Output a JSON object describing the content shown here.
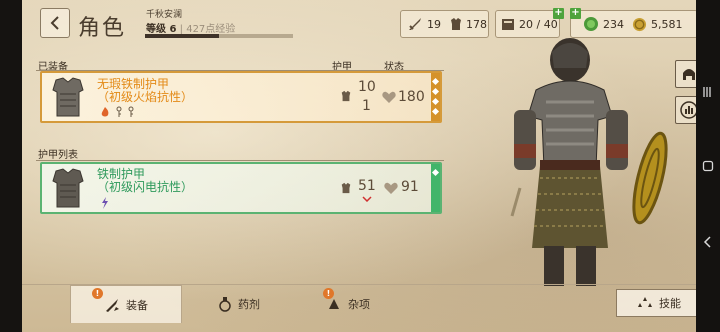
{
  "header": {
    "back_icon": "chevron-left-icon",
    "title": "角色",
    "player_name": "千秋安澜",
    "level_label": "等级 6",
    "exp_text": "427点经验",
    "exp_progress": 0.5
  },
  "stats": {
    "attack": "19",
    "armor": "178",
    "inventory": "20 / 40",
    "gems": "234",
    "gold": "5,581"
  },
  "equipped": {
    "section_label": "已装备",
    "armor_header": "护甲",
    "status_header": "状态",
    "item": {
      "name_line1": "无瑕铁制护甲",
      "name_line2": "（初级火焰抗性）",
      "armor_top": "10",
      "armor_bottom": "1",
      "condition": "180",
      "accent_color": "#d5922a"
    }
  },
  "armor_list": {
    "section_label": "护甲列表",
    "item": {
      "name_line1": "铁制护甲",
      "name_line2": "（初级闪电抗性）",
      "armor": "51",
      "condition": "91",
      "accent_color": "#41b56a"
    }
  },
  "tabs": [
    {
      "label": "装备",
      "icon": "equipment-icon",
      "active": true,
      "alert": true
    },
    {
      "label": "药剂",
      "icon": "potion-icon",
      "active": false,
      "alert": false
    },
    {
      "label": "杂项",
      "icon": "misc-icon",
      "active": false,
      "alert": true
    }
  ],
  "skills_button": {
    "label": "技能",
    "icon": "skills-icon"
  },
  "alert_glyph": "!"
}
